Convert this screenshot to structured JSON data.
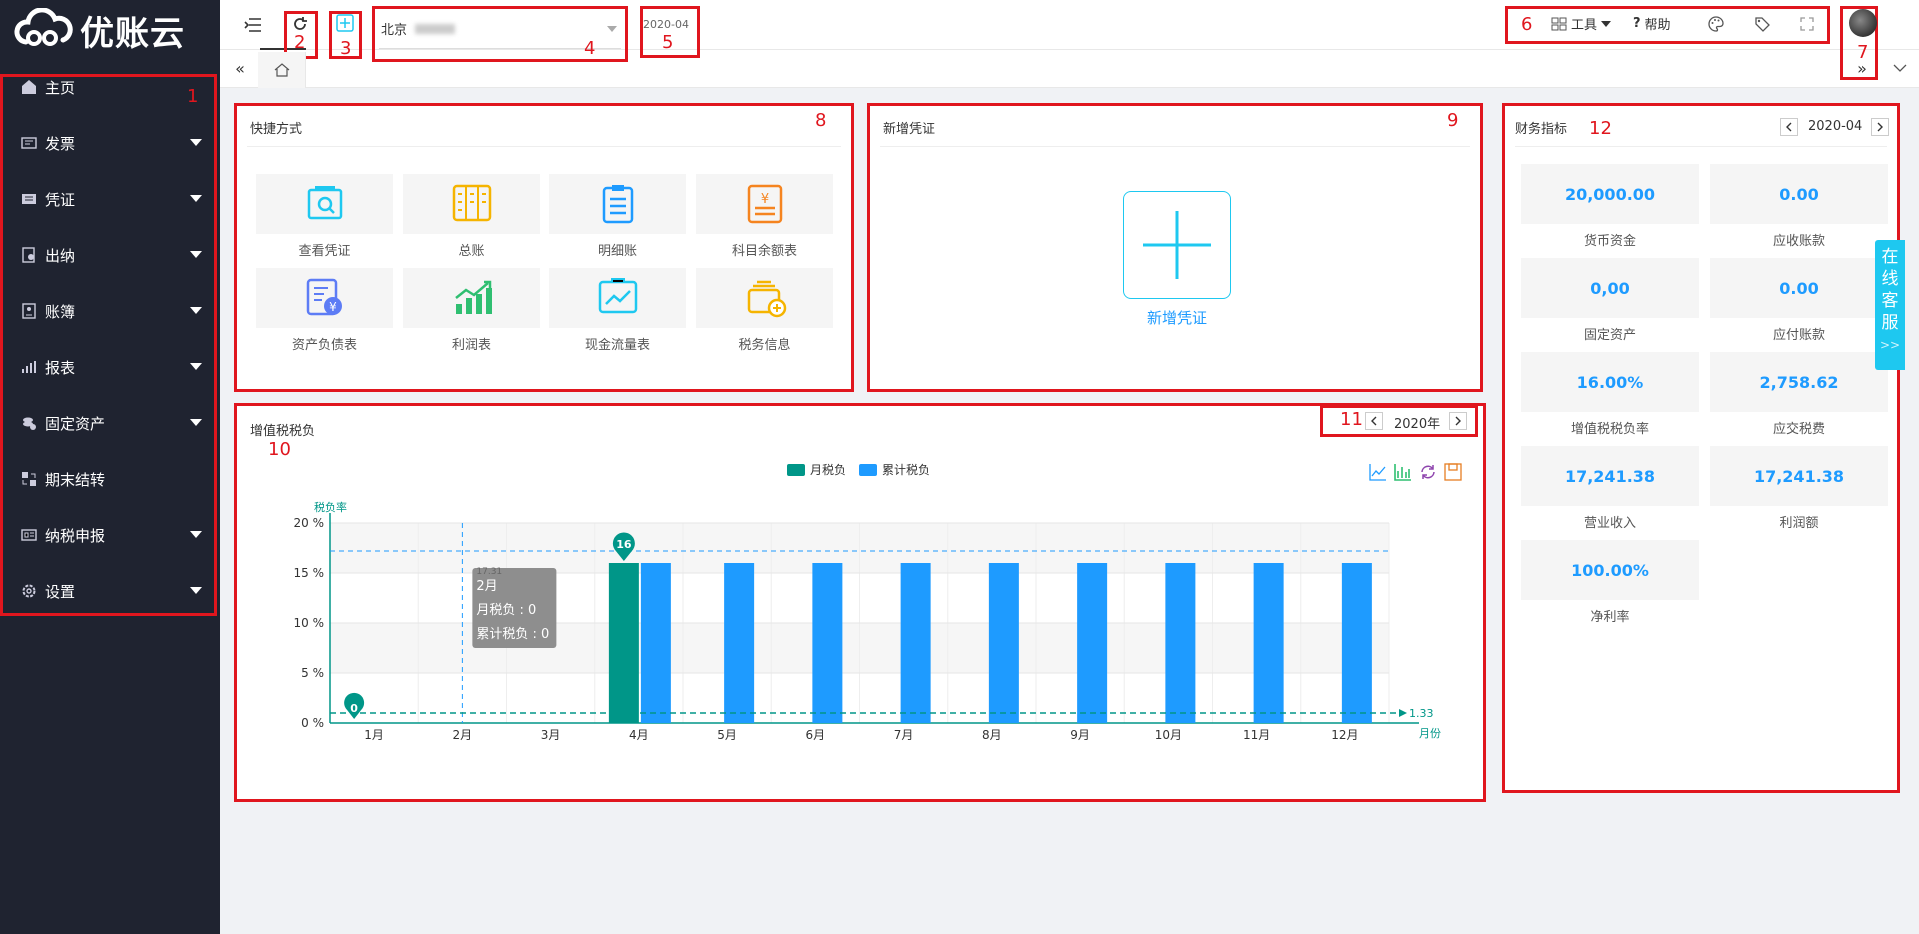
{
  "app": {
    "logo_text": "优账云"
  },
  "colors": {
    "sidebar_bg": "#1f2330",
    "accent": "#1e9bff",
    "monthly": "#009688",
    "cumulative": "#1e9bff",
    "annotation_red": "#e0161e"
  },
  "sidebar": {
    "items": [
      {
        "label": "主页",
        "icon": "home-icon",
        "has_children": false
      },
      {
        "label": "发票",
        "icon": "invoice-icon",
        "has_children": true
      },
      {
        "label": "凭证",
        "icon": "voucher-icon",
        "has_children": true
      },
      {
        "label": "出纳",
        "icon": "cashier-icon",
        "has_children": true
      },
      {
        "label": "账簿",
        "icon": "ledger-icon",
        "has_children": true
      },
      {
        "label": "报表",
        "icon": "report-icon",
        "has_children": true
      },
      {
        "label": "固定资产",
        "icon": "fixed-assets-icon",
        "has_children": true
      },
      {
        "label": "期末结转",
        "icon": "period-end-icon",
        "has_children": false
      },
      {
        "label": "纳税申报",
        "icon": "tax-filing-icon",
        "has_children": true
      },
      {
        "label": "设置",
        "icon": "settings-icon",
        "has_children": true
      }
    ]
  },
  "topbar": {
    "company": "北京",
    "period": "2020-04",
    "tools_label": "工具",
    "help_label": "帮助"
  },
  "annotations": [
    "1",
    "2",
    "3",
    "4",
    "5",
    "6",
    "7",
    "8",
    "9",
    "10",
    "11",
    "12"
  ],
  "shortcuts": {
    "title": "快捷方式",
    "items": [
      {
        "label": "查看凭证",
        "icon": "view-voucher-icon"
      },
      {
        "label": "总账",
        "icon": "general-ledger-icon"
      },
      {
        "label": "明细账",
        "icon": "detail-ledger-icon"
      },
      {
        "label": "科目余额表",
        "icon": "balance-sheet-icon"
      },
      {
        "label": "资产负债表",
        "icon": "assets-liabilities-icon"
      },
      {
        "label": "利润表",
        "icon": "profit-chart-icon"
      },
      {
        "label": "现金流量表",
        "icon": "cash-flow-icon"
      },
      {
        "label": "税务信息",
        "icon": "tax-info-icon"
      }
    ]
  },
  "new_voucher": {
    "title": "新增凭证",
    "button_label": "新增凭证"
  },
  "finance": {
    "title": "财务指标",
    "period": "2020-04",
    "kpis": [
      {
        "value": "20,000.00",
        "label": "货币资金"
      },
      {
        "value": "0.00",
        "label": "应收账款"
      },
      {
        "value": "0,00",
        "label": "固定资产"
      },
      {
        "value": "0.00",
        "label": "应付账款"
      },
      {
        "value": "16.00%",
        "label": "增值税税负率"
      },
      {
        "value": "2,758.62",
        "label": "应交税费"
      },
      {
        "value": "17,241.38",
        "label": "营业收入"
      },
      {
        "value": "17,241.38",
        "label": "利润额"
      },
      {
        "value": "100.00%",
        "label": "净利率"
      }
    ]
  },
  "online_service": {
    "chars": [
      "在",
      "线",
      "客",
      "服"
    ],
    "arrow": ">>"
  },
  "chart_panel": {
    "title": "增值税税负",
    "year_label": "2020年"
  },
  "chart_data": {
    "type": "bar",
    "ylabel": "税负率",
    "xlabel": "月份",
    "categories": [
      "1月",
      "2月",
      "3月",
      "4月",
      "5月",
      "6月",
      "7月",
      "8月",
      "9月",
      "10月",
      "11月",
      "12月"
    ],
    "series": [
      {
        "name": "月税负",
        "values": [
          0,
          0,
          0,
          16,
          0,
          0,
          0,
          0,
          0,
          0,
          0,
          0
        ]
      },
      {
        "name": "累计税负",
        "values": [
          0,
          0,
          0,
          16,
          16,
          16,
          16,
          16,
          16,
          16,
          16,
          16
        ]
      }
    ],
    "ylim": [
      0,
      20
    ],
    "yticks": [
      "0 %",
      "5 %",
      "10 %",
      "15 %",
      "20 %"
    ],
    "yticks_values": [
      0,
      5,
      10,
      15,
      20
    ],
    "markline_avg_value": "1.33",
    "markline_max_value": 17.2,
    "max_marker": "16",
    "min_marker": "0",
    "tooltip": {
      "faded": "17.31",
      "title": "2月",
      "line1": "月税负 : 0",
      "line2": "累计税负 : 0"
    },
    "legend_position": "top-center",
    "grid": true
  }
}
